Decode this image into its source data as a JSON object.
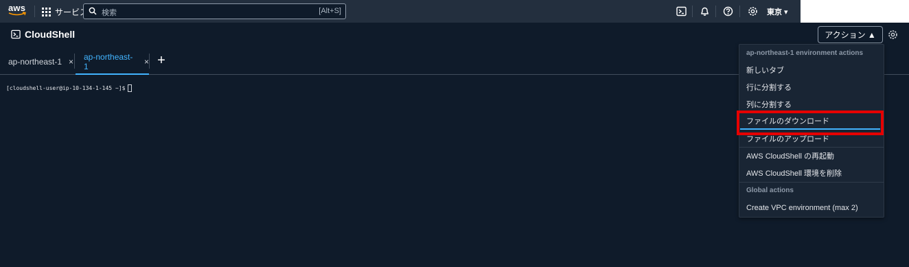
{
  "nav": {
    "logo_text": "aws",
    "services_label": "サービス",
    "search_placeholder": "検索",
    "search_shortcut": "[Alt+S]",
    "icons": [
      "cloudshell-icon",
      "bell-icon",
      "help-icon",
      "gear-icon"
    ],
    "region_label": "東京 ▾"
  },
  "header": {
    "title": "CloudShell",
    "actions_label": "アクション ▲"
  },
  "tabs": [
    {
      "label": "ap-northeast-1",
      "close": "×",
      "active": false
    },
    {
      "label": "ap-northeast-1",
      "close": "×",
      "active": true
    }
  ],
  "add_tab_label": "+",
  "terminal": {
    "prompt": "[cloudshell-user@ip-10-134-1-145 ~]$"
  },
  "dropdown": {
    "group1_title": "ap-northeast-1 environment actions",
    "group1_items": [
      "新しいタブ",
      "行に分割する",
      "列に分割する",
      "ファイルのダウンロード",
      "ファイルのアップロード",
      "AWS CloudShell の再起動",
      "AWS CloudShell 環境を削除"
    ],
    "group2_title": "Global actions",
    "group2_items": [
      "Create VPC environment (max 2)"
    ]
  },
  "colors": {
    "nav_bg": "#232f3e",
    "page_bg": "#0f1b2a",
    "accent": "#42b4ff",
    "highlight": "#e60000"
  }
}
